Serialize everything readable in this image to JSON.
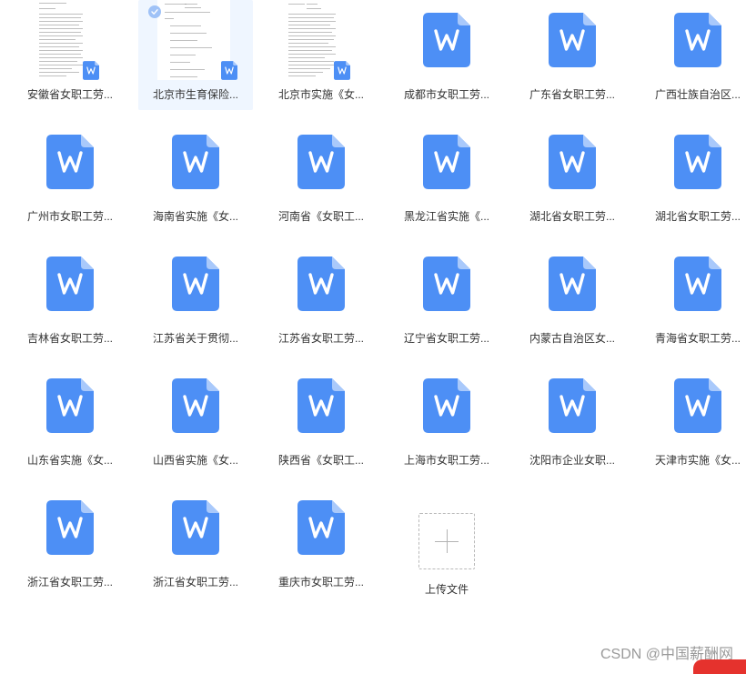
{
  "files": [
    {
      "name": "安徽省女职工劳...",
      "type": "doc-preview",
      "selected": false
    },
    {
      "name": "北京市生育保险...",
      "type": "doc-preview",
      "selected": true
    },
    {
      "name": "北京市实施《女...",
      "type": "doc-preview",
      "selected": false
    },
    {
      "name": "成都市女职工劳...",
      "type": "word-icon",
      "selected": false
    },
    {
      "name": "广东省女职工劳...",
      "type": "word-icon",
      "selected": false
    },
    {
      "name": "广西壮族自治区...",
      "type": "word-icon",
      "selected": false
    },
    {
      "name": "广州市女职工劳...",
      "type": "word-icon",
      "selected": false
    },
    {
      "name": "海南省实施《女...",
      "type": "word-icon",
      "selected": false
    },
    {
      "name": "河南省《女职工...",
      "type": "word-icon",
      "selected": false
    },
    {
      "name": "黑龙江省实施《...",
      "type": "word-icon",
      "selected": false
    },
    {
      "name": "湖北省女职工劳...",
      "type": "word-icon",
      "selected": false
    },
    {
      "name": "湖北省女职工劳...",
      "type": "word-icon",
      "selected": false
    },
    {
      "name": "吉林省女职工劳...",
      "type": "word-icon",
      "selected": false
    },
    {
      "name": "江苏省关于贯彻...",
      "type": "word-icon",
      "selected": false
    },
    {
      "name": "江苏省女职工劳...",
      "type": "word-icon",
      "selected": false
    },
    {
      "name": "辽宁省女职工劳...",
      "type": "word-icon",
      "selected": false
    },
    {
      "name": "内蒙古自治区女...",
      "type": "word-icon",
      "selected": false
    },
    {
      "name": "青海省女职工劳...",
      "type": "word-icon",
      "selected": false
    },
    {
      "name": "山东省实施《女...",
      "type": "word-icon",
      "selected": false
    },
    {
      "name": "山西省实施《女...",
      "type": "word-icon",
      "selected": false
    },
    {
      "name": "陕西省《女职工...",
      "type": "word-icon",
      "selected": false
    },
    {
      "name": "上海市女职工劳...",
      "type": "word-icon",
      "selected": false
    },
    {
      "name": "沈阳市企业女职...",
      "type": "word-icon",
      "selected": false
    },
    {
      "name": "天津市实施《女...",
      "type": "word-icon",
      "selected": false
    },
    {
      "name": "浙江省女职工劳...",
      "type": "word-icon",
      "selected": false
    },
    {
      "name": "浙江省女职工劳...",
      "type": "word-icon",
      "selected": false
    },
    {
      "name": "重庆市女职工劳...",
      "type": "word-icon",
      "selected": false
    }
  ],
  "upload": {
    "label": "上传文件",
    "icon": "plus-icon"
  },
  "watermark": "CSDN @中国薪酬网",
  "colors": {
    "word_icon": "#4d8ff5",
    "word_icon_fold": "#a9c9fb",
    "selected_bg": "#eff6ff",
    "label_text": "#333333"
  }
}
